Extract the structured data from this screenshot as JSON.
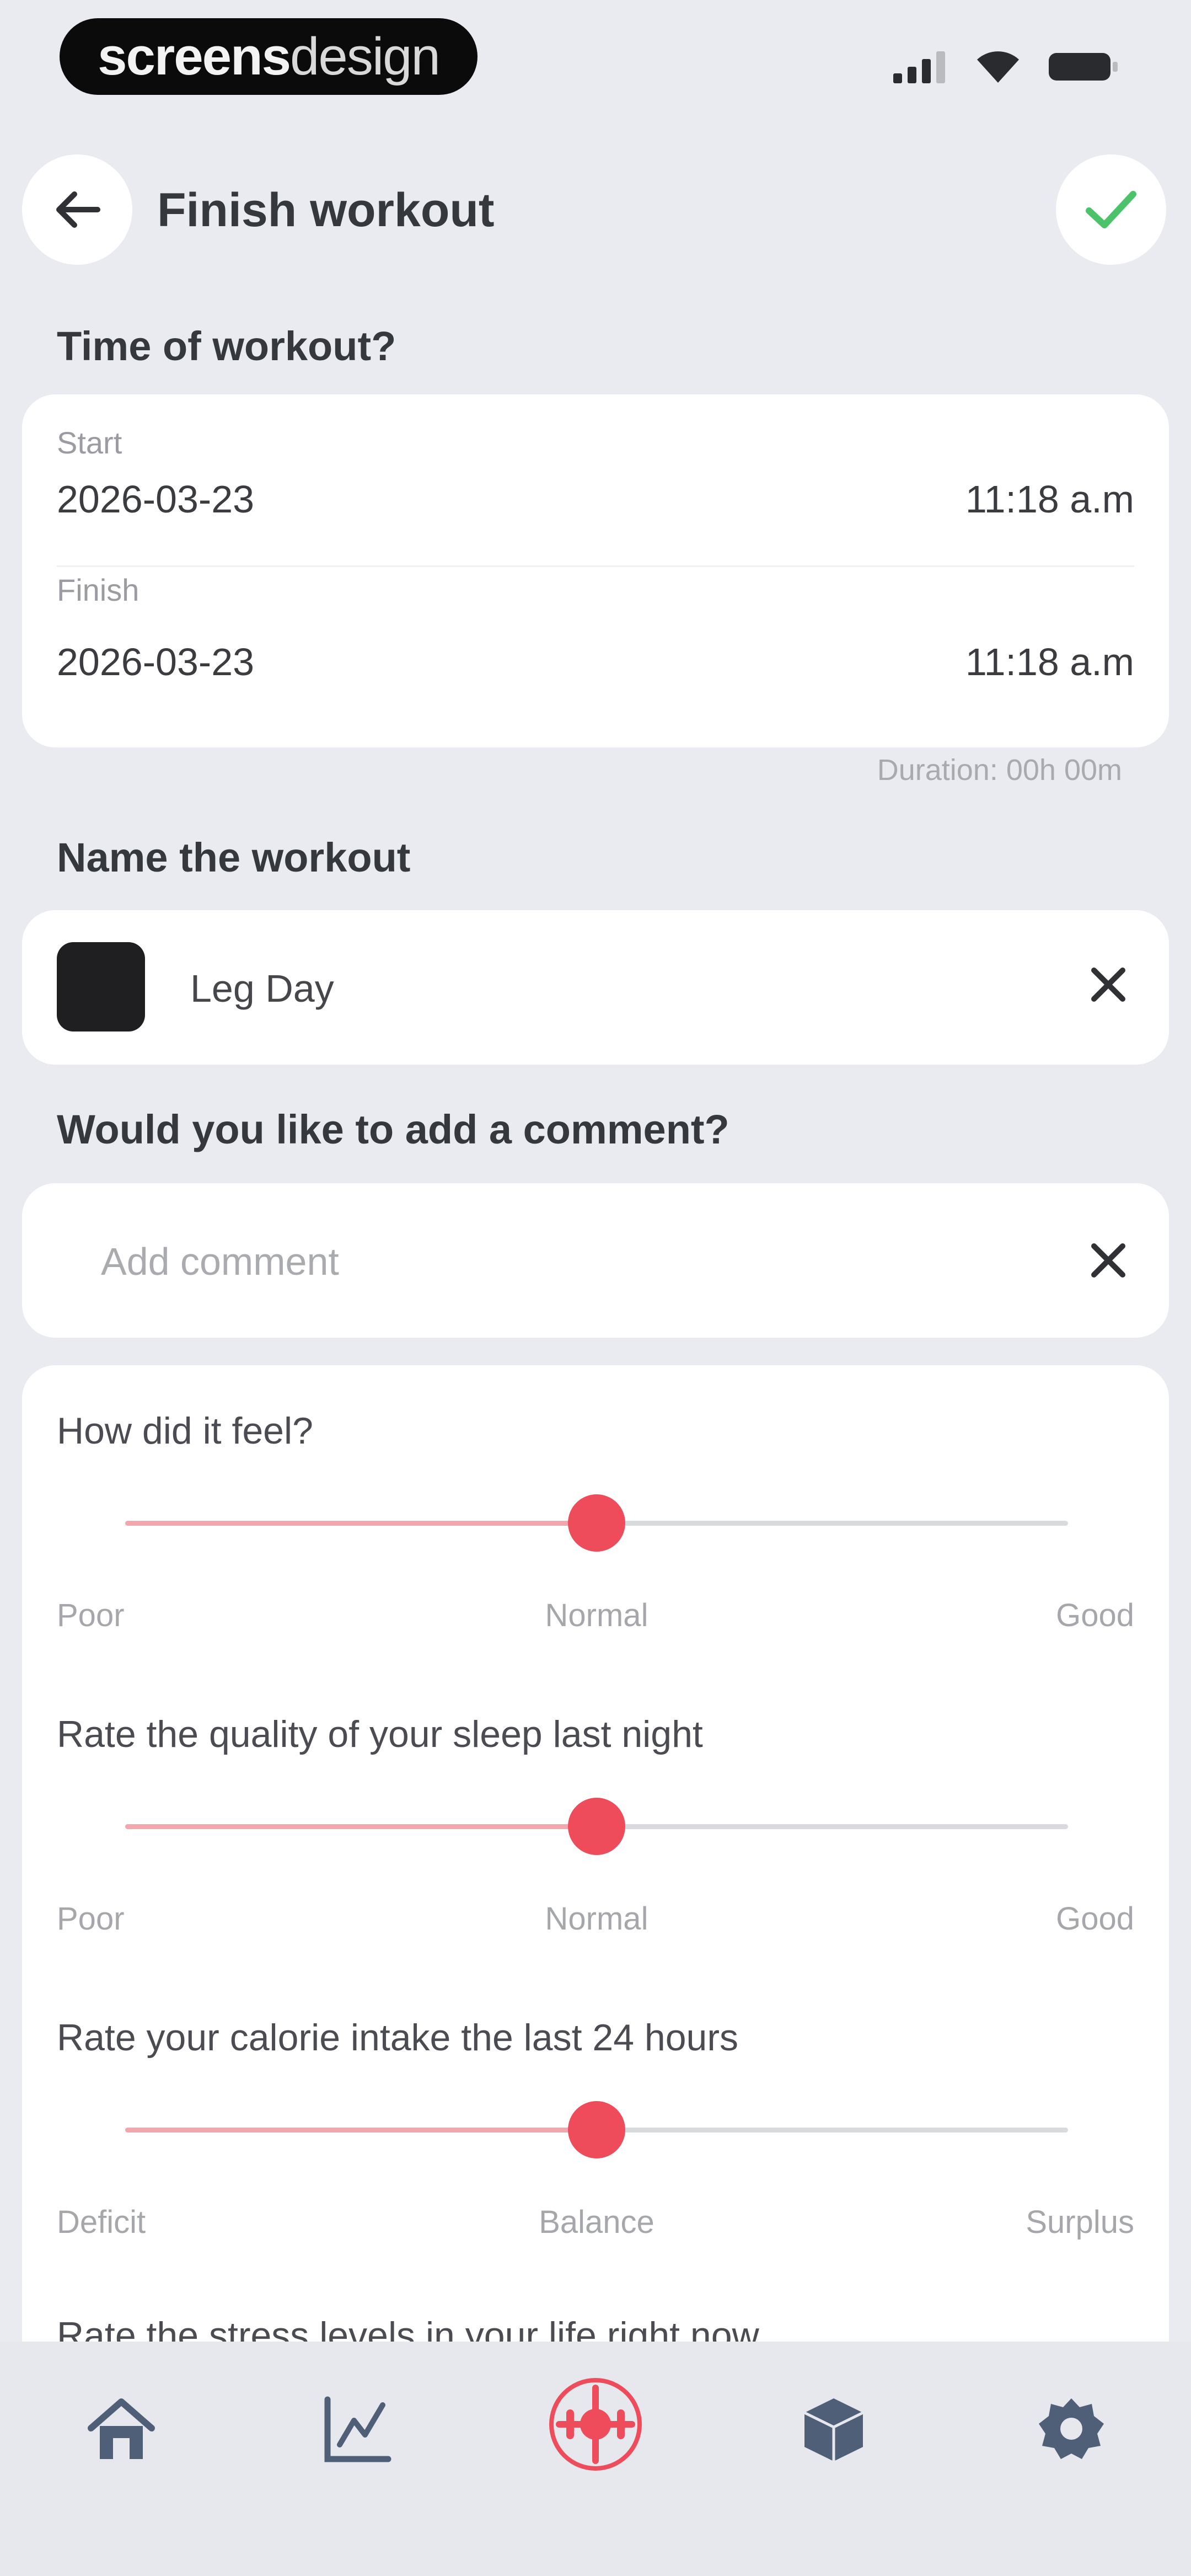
{
  "status_bar": {
    "brand_bold": "screens",
    "brand_light": "design",
    "icons": [
      "signal-icon",
      "wifi-icon",
      "battery-icon"
    ]
  },
  "header": {
    "title": "Finish workout",
    "back_icon": "back-arrow-icon",
    "confirm_icon": "checkmark-icon"
  },
  "time_section": {
    "title": "Time of workout?",
    "start_label": "Start",
    "start_date": "2026-03-23",
    "start_time": "11:18 a.m",
    "finish_label": "Finish",
    "finish_date": "2026-03-23",
    "finish_time": "11:18 a.m",
    "duration": "Duration: 00h 00m"
  },
  "name_section": {
    "title": "Name the workout",
    "value": "Leg Day",
    "swatch_color": "#1f1f21"
  },
  "comment_section": {
    "title": "Would you like to add a comment?",
    "placeholder": "Add comment"
  },
  "ratings": [
    {
      "question": "How did it feel?",
      "low": "Poor",
      "mid": "Normal",
      "high": "Good",
      "value": 0.5
    },
    {
      "question": "Rate the quality of your sleep last night",
      "low": "Poor",
      "mid": "Normal",
      "high": "Good",
      "value": 0.5
    },
    {
      "question": "Rate your calorie intake the last 24 hours",
      "low": "Deficit",
      "mid": "Balance",
      "high": "Surplus",
      "value": 0.5
    },
    {
      "question": "Rate the stress levels in your life right now"
    }
  ],
  "bottom_nav": {
    "items": [
      "home-icon",
      "chart-icon",
      "workout-icon",
      "cube-icon",
      "settings-icon"
    ]
  },
  "colors": {
    "accent": "#ee4c5b",
    "accent_light": "#f2a6ad",
    "confirm": "#4cc36b",
    "background": "#e9ebf1",
    "card": "#ffffff"
  }
}
